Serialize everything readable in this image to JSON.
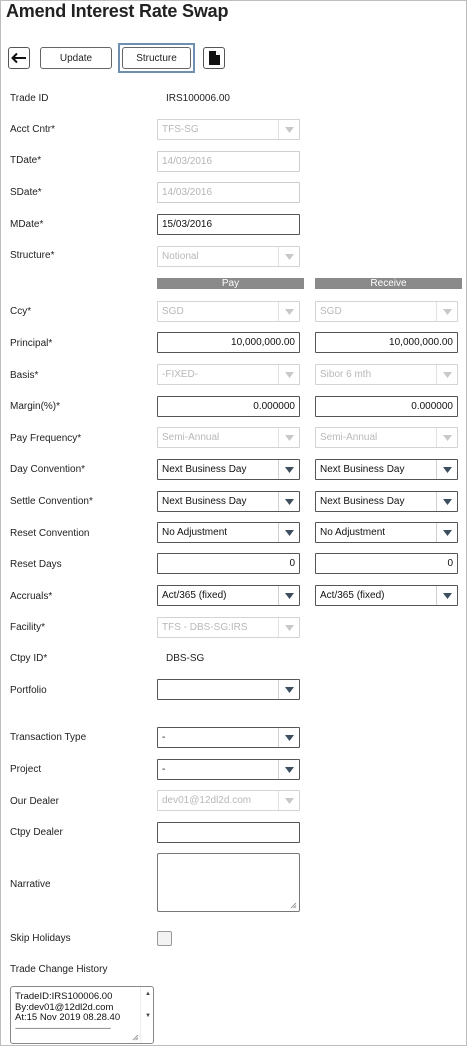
{
  "title": "Amend Interest Rate Swap",
  "toolbar": {
    "update_label": "Update",
    "structure_label": "Structure"
  },
  "columns": {
    "pay": "Pay",
    "receive": "Receive"
  },
  "fields": {
    "trade_id": {
      "label": "Trade ID",
      "value": "IRS100006.00"
    },
    "acct_cntr": {
      "label": "Acct Cntr*",
      "value": "TFS-SG"
    },
    "tdate": {
      "label": "TDate*",
      "value": "14/03/2016"
    },
    "sdate": {
      "label": "SDate*",
      "value": "14/03/2016"
    },
    "mdate": {
      "label": "MDate*",
      "value": "15/03/2016"
    },
    "structure": {
      "label": "Structure*",
      "value": "Notional"
    },
    "ccy": {
      "label": "Ccy*",
      "pay": "SGD",
      "receive": "SGD"
    },
    "principal": {
      "label": "Principal*",
      "pay": "10,000,000.00",
      "receive": "10,000,000.00"
    },
    "basis": {
      "label": "Basis*",
      "pay": "-FIXED-",
      "receive": "Sibor 6 mth"
    },
    "margin": {
      "label": "Margin(%)*",
      "pay": "0.000000",
      "receive": "0.000000"
    },
    "pay_frequency": {
      "label": "Pay Frequency*",
      "pay": "Semi-Annual",
      "receive": "Semi-Annual"
    },
    "day_convention": {
      "label": "Day Convention*",
      "pay": "Next Business Day",
      "receive": "Next Business Day"
    },
    "settle_convention": {
      "label": "Settle Convention*",
      "pay": "Next Business Day",
      "receive": "Next Business Day"
    },
    "reset_convention": {
      "label": "Reset Convention",
      "pay": "No Adjustment",
      "receive": "No Adjustment"
    },
    "reset_days": {
      "label": "Reset Days",
      "pay": "0",
      "receive": "0"
    },
    "accruals": {
      "label": "Accruals*",
      "pay": "Act/365 (fixed)",
      "receive": "Act/365 (fixed)"
    },
    "facility": {
      "label": "Facility*",
      "value": "TFS - DBS-SG:IRS"
    },
    "ctpy_id": {
      "label": "Ctpy ID*",
      "value": "DBS-SG"
    },
    "portfolio": {
      "label": "Portfolio",
      "value": ""
    },
    "transaction_type": {
      "label": "Transaction Type",
      "value": "-"
    },
    "project": {
      "label": "Project",
      "value": "-"
    },
    "our_dealer": {
      "label": "Our Dealer",
      "value": "dev01@12dl2d.com"
    },
    "ctpy_dealer": {
      "label": "Ctpy Dealer",
      "value": ""
    },
    "narrative": {
      "label": "Narrative",
      "value": ""
    },
    "skip_holidays": {
      "label": "Skip Holidays"
    },
    "trade_change_history": {
      "label": "Trade Change History",
      "lines": [
        "TradeID:IRS100006.00",
        "By:dev01@12dl2d.com",
        "At:15 Nov 2019 08.28.40",
        "--------------------------------------------"
      ]
    }
  }
}
